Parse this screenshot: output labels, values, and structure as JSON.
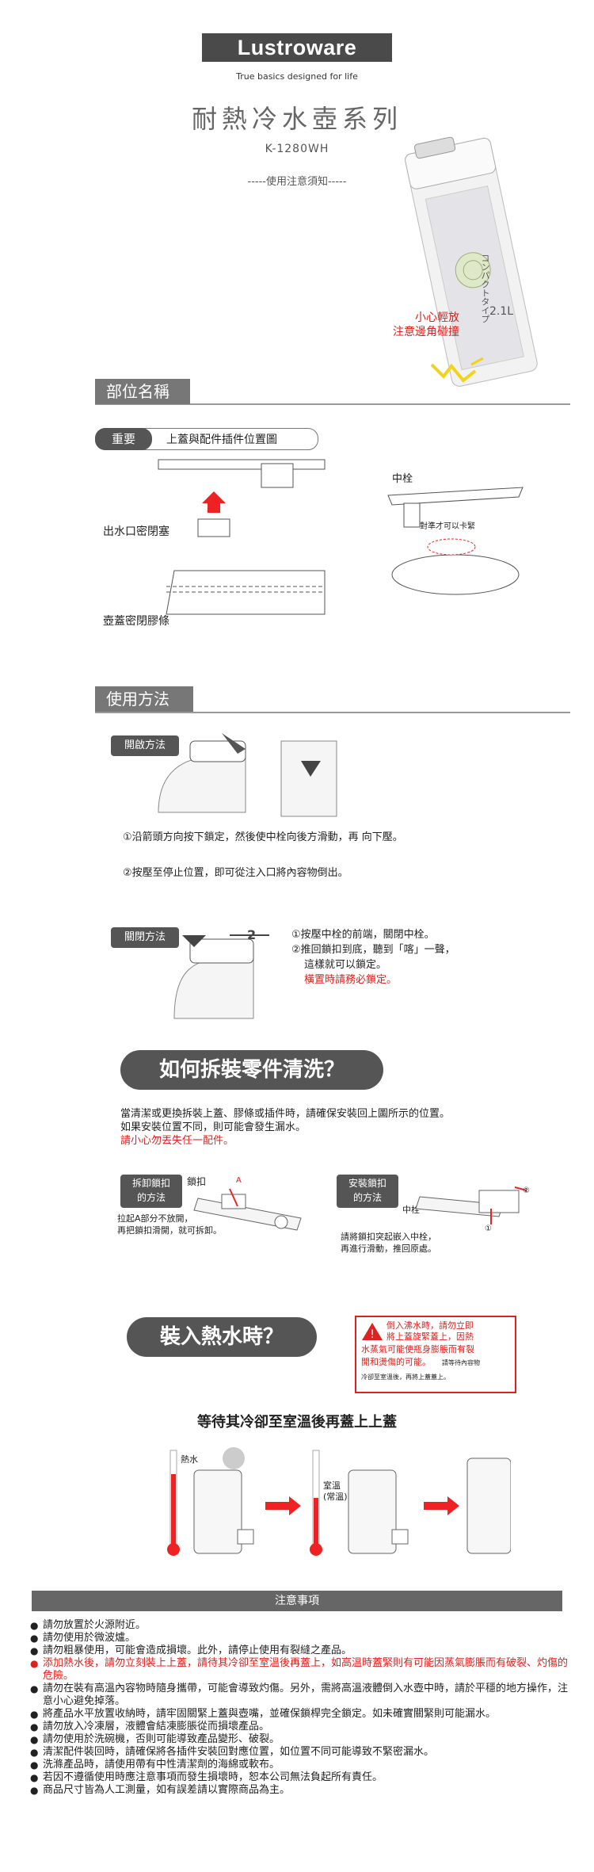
{
  "header": {
    "brand": "Lustroware",
    "tagline": "True basics designed for life",
    "series": "耐熱冷水壺系列",
    "model": "K-1280WH",
    "subtitle": "-----使用注意須知-----",
    "caution": [
      "小心輕放",
      "注意邊角碰撞"
    ],
    "product_label_1": "コンパクトタイプ",
    "product_label_2": "2.1L"
  },
  "parts": {
    "section_title": "部位名稱",
    "important_tag": "重要",
    "important_title": "上蓋與配件插件位置圖",
    "spout_plug": "出水口密閉塞",
    "lid_gasket": "壺蓋密閉膠條",
    "center_plug": "中栓",
    "align_hint": "對準才可以卡緊"
  },
  "usage": {
    "section_title": "使用方法",
    "open_tag": "開啟方法",
    "open_steps": [
      "①沿箭頭方向按下鎖定，然後使中栓向後方滑動，再 向下壓。",
      "②按壓至停止位置，即可從注入口將內容物倒出。"
    ],
    "close_tag": "關閉方法",
    "close_steps": [
      "①按壓中栓的前端，關閉中栓。",
      "②推回鎖扣到底，聽到「喀」一聲，",
      "這樣就可以鎖定。",
      "橫置時請務必鎖定。"
    ],
    "arrow_num": "2"
  },
  "cleaning": {
    "bubble": "如何拆裝零件清洗？",
    "intro": [
      "當清潔或更換拆裝上蓋、膠條或插件時，請確保安裝回上圖所示的位置。",
      "如果安裝位置不同，則可能會發生漏水。",
      "請小心勿丟失任一配件。"
    ],
    "remove_tag": [
      "拆卸鎖扣",
      "的方法"
    ],
    "remove_lock": "鎖扣",
    "remove_label_a": "A",
    "remove_desc": [
      "拉起A部分不放開，",
      "再把鎖扣滑開，就可拆卸。"
    ],
    "install_tag": [
      "安裝鎖扣",
      "的方法"
    ],
    "install_center": "中栓",
    "install_desc": [
      "請將鎖扣突起嵌入中栓，",
      "再進行滑動，推回原處。"
    ],
    "num_1": "①",
    "num_2": "②"
  },
  "hot_water": {
    "bubble": "裝入熱水時？",
    "warning": [
      "倒入沸水時，請勿立即",
      "將上蓋旋緊蓋上，因熱",
      "水蒸氣可能使瓶身膨脹而有裂",
      "開和燙傷的可能。",
      "請等待內容物",
      "冷卻至室溫後，再將上蓋蓋上。"
    ],
    "instruction": "等待其冷卻至室溫後再蓋上上蓋",
    "hot_label": "熱水",
    "room_label": [
      "室溫",
      "(常溫)"
    ]
  },
  "notes": {
    "title": "注意事項",
    "items": [
      {
        "text": "請勿放置於火源附近。",
        "warn": false
      },
      {
        "text": "請勿使用於微波爐。",
        "warn": false
      },
      {
        "text": "請勿粗暴使用，可能會造成損壞。此外，請停止使用有裂縫之產品。",
        "warn": false
      },
      {
        "text": "添加熱水後，請勿立刻裝上上蓋，請待其冷卻至室溫後再蓋上，如高溫時蓋緊則有可能因蒸氣膨脹而有破裂、灼傷的危險。",
        "warn": true
      },
      {
        "text": "請勿在裝有高溫內容物時隨身攜帶，可能會導致灼傷。另外，需將高溫液體倒入水壺中時，請於平穩的地方操作，注意小心避免掉落。",
        "warn": false
      },
      {
        "text": "將產品水平放置收納時，請牢固關緊上蓋與壺嘴，並確保鎖桿完全鎖定。如未確實關緊則可能漏水。",
        "warn": false
      },
      {
        "text": "請勿放入冷凍層，液體會結凍膨脹從而損壞產品。",
        "warn": false
      },
      {
        "text": "請勿使用於洗碗機，否則可能導致產品變形、破裂。",
        "warn": false
      },
      {
        "text": "清潔配件裝回時，請確保將各插件安裝回對應位置，如位置不同可能導致不緊密漏水。",
        "warn": false
      },
      {
        "text": "洗滌產品時，請使用帶有中性清潔劑的海綿或軟布。",
        "warn": false
      },
      {
        "text": "若因不遵循使用時應注意事項而發生損壞時，恕本公司無法負起所有責任。",
        "warn": false
      },
      {
        "text": "商品尺寸皆為人工測量，如有誤差請以實際商品為主。",
        "warn": false
      }
    ]
  }
}
